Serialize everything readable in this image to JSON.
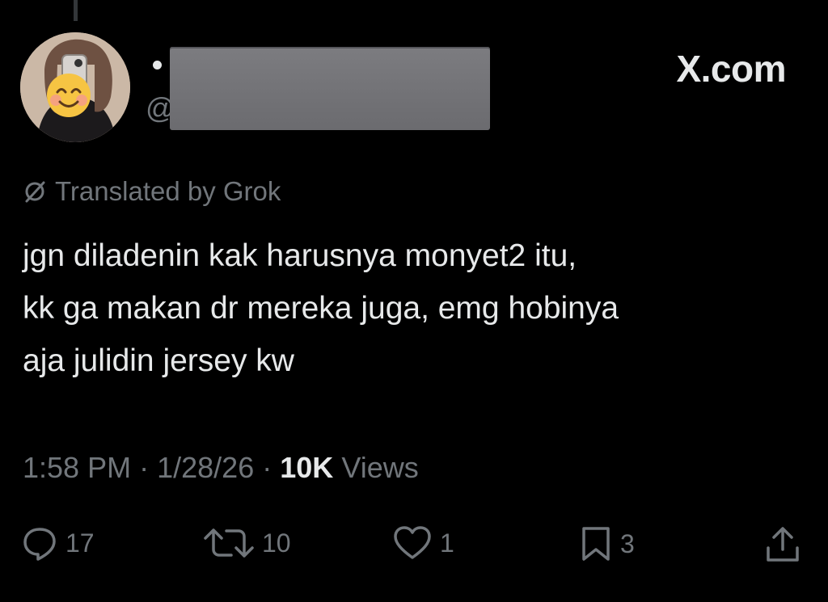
{
  "header": {
    "brand": "X.com",
    "handle_prefix": "@",
    "name_redacted": true
  },
  "post": {
    "translated_label": "Translated by Grok",
    "text_lines": [
      "jgn diladenin kak harusnya monyet2 itu,",
      "kk ga makan dr mereka juga, emg hobinya",
      "aja julidin jersey kw"
    ],
    "time": "1:58 PM",
    "separator": "·",
    "date": "1/28/26",
    "views_count": "10K",
    "views_label": "Views"
  },
  "actions": {
    "replies": "17",
    "reposts": "10",
    "likes": "1",
    "bookmarks": "3"
  },
  "icons": [
    "reply-icon",
    "repost-icon",
    "like-icon",
    "bookmark-icon",
    "share-icon",
    "translate-icon"
  ],
  "colors": {
    "background": "#000000",
    "text": "#e7e9ea",
    "muted": "#71767b"
  }
}
